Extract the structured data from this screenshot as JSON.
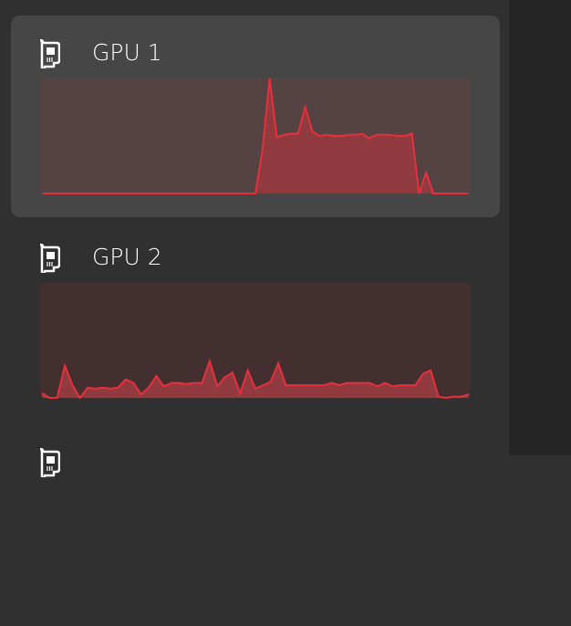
{
  "sidebar": {
    "items": [
      {
        "label": "GPU 1",
        "icon": "gpu-icon",
        "selected": true,
        "graph_bg": "#554242",
        "usage_history": [
          0,
          0,
          0,
          0,
          0,
          0,
          0,
          0,
          0,
          0,
          0,
          0,
          0,
          0,
          0,
          0,
          0,
          0,
          0,
          0,
          0,
          0,
          0,
          0,
          0,
          0,
          0,
          0,
          0,
          0,
          0,
          38,
          100,
          49,
          51,
          52,
          52,
          75,
          54,
          50,
          51,
          50,
          50,
          51,
          51,
          52,
          48,
          51,
          51,
          51,
          50,
          50,
          52,
          0,
          18,
          0,
          0,
          0,
          0,
          0,
          0
        ]
      },
      {
        "label": "GPU 2",
        "icon": "gpu-icon",
        "selected": false,
        "graph_bg": "#432f30",
        "usage_history": [
          4,
          0,
          0,
          28,
          11,
          0,
          9,
          8,
          9,
          8,
          9,
          16,
          13,
          3,
          9,
          19,
          10,
          13,
          13,
          12,
          13,
          13,
          32,
          10,
          18,
          22,
          4,
          24,
          8,
          11,
          14,
          30,
          11,
          11,
          11,
          11,
          11,
          11,
          13,
          11,
          13,
          13,
          13,
          13,
          10,
          13,
          10,
          11,
          11,
          11,
          21,
          24,
          1,
          0,
          1,
          1,
          3
        ]
      },
      {
        "label": "",
        "icon": "drive-icon",
        "selected": false
      }
    ]
  },
  "colors": {
    "line": "#e8303c",
    "fill": "#913b41",
    "selected_bg": "#464646",
    "background": "#303030"
  }
}
